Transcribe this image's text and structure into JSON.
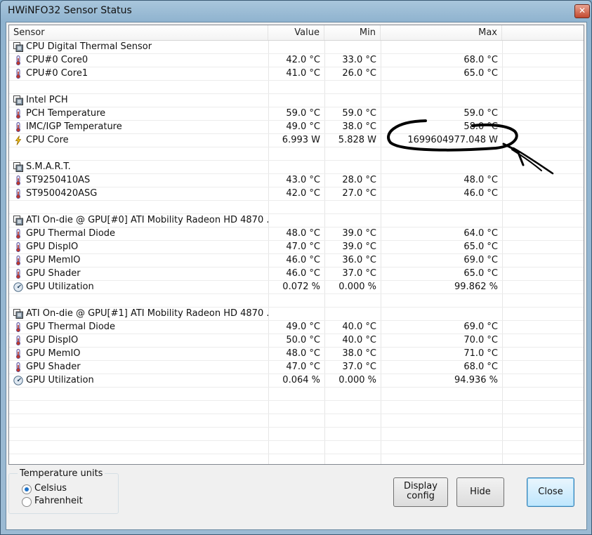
{
  "window": {
    "title": "HWiNFO32 Sensor Status"
  },
  "columns": {
    "sensor": "Sensor",
    "value": "Value",
    "min": "Min",
    "max": "Max"
  },
  "rows": [
    {
      "kind": "group",
      "icon": "chip-icon",
      "name": "CPU Digital Thermal Sensor",
      "value": "",
      "min": "",
      "max": ""
    },
    {
      "kind": "sensor",
      "icon": "thermometer-icon",
      "name": "CPU#0 Core0",
      "value": "42.0 °C",
      "min": "33.0 °C",
      "max": "68.0 °C"
    },
    {
      "kind": "sensor",
      "icon": "thermometer-icon",
      "name": "CPU#0 Core1",
      "value": "41.0 °C",
      "min": "26.0 °C",
      "max": "65.0 °C"
    },
    {
      "kind": "blank",
      "icon": "",
      "name": "",
      "value": "",
      "min": "",
      "max": ""
    },
    {
      "kind": "group",
      "icon": "chip-icon",
      "name": "Intel PCH",
      "value": "",
      "min": "",
      "max": ""
    },
    {
      "kind": "sensor",
      "icon": "thermometer-icon",
      "name": "PCH Temperature",
      "value": "59.0 °C",
      "min": "59.0 °C",
      "max": "59.0 °C"
    },
    {
      "kind": "sensor",
      "icon": "thermometer-icon",
      "name": "IMC/IGP Temperature",
      "value": "49.0 °C",
      "min": "38.0 °C",
      "max": "58.0 °C"
    },
    {
      "kind": "sensor",
      "icon": "lightning-icon",
      "name": "CPU Core",
      "value": "6.993 W",
      "min": "5.828 W",
      "max": "1699604977.048 W"
    },
    {
      "kind": "blank",
      "icon": "",
      "name": "",
      "value": "",
      "min": "",
      "max": ""
    },
    {
      "kind": "group",
      "icon": "chip-icon",
      "name": "S.M.A.R.T.",
      "value": "",
      "min": "",
      "max": ""
    },
    {
      "kind": "sensor",
      "icon": "thermometer-icon",
      "name": "ST9250410AS",
      "value": "43.0 °C",
      "min": "28.0 °C",
      "max": "48.0 °C"
    },
    {
      "kind": "sensor",
      "icon": "thermometer-icon",
      "name": "ST9500420ASG",
      "value": "42.0 °C",
      "min": "27.0 °C",
      "max": "46.0 °C"
    },
    {
      "kind": "blank",
      "icon": "",
      "name": "",
      "value": "",
      "min": "",
      "max": ""
    },
    {
      "kind": "group",
      "icon": "chip-icon",
      "name": "ATI On-die @ GPU[#0] ATI Mobility Radeon HD 4870 ...",
      "value": "",
      "min": "",
      "max": ""
    },
    {
      "kind": "sensor",
      "icon": "thermometer-icon",
      "name": "GPU Thermal Diode",
      "value": "48.0 °C",
      "min": "39.0 °C",
      "max": "64.0 °C"
    },
    {
      "kind": "sensor",
      "icon": "thermometer-icon",
      "name": "GPU DispIO",
      "value": "47.0 °C",
      "min": "39.0 °C",
      "max": "65.0 °C"
    },
    {
      "kind": "sensor",
      "icon": "thermometer-icon",
      "name": "GPU MemIO",
      "value": "46.0 °C",
      "min": "36.0 °C",
      "max": "69.0 °C"
    },
    {
      "kind": "sensor",
      "icon": "thermometer-icon",
      "name": "GPU Shader",
      "value": "46.0 °C",
      "min": "37.0 °C",
      "max": "65.0 °C"
    },
    {
      "kind": "sensor",
      "icon": "gauge-icon",
      "name": "GPU Utilization",
      "value": "0.072 %",
      "min": "0.000 %",
      "max": "99.862 %"
    },
    {
      "kind": "blank",
      "icon": "",
      "name": "",
      "value": "",
      "min": "",
      "max": ""
    },
    {
      "kind": "group",
      "icon": "chip-icon",
      "name": "ATI On-die @ GPU[#1] ATI Mobility Radeon HD 4870 ...",
      "value": "",
      "min": "",
      "max": ""
    },
    {
      "kind": "sensor",
      "icon": "thermometer-icon",
      "name": "GPU Thermal Diode",
      "value": "49.0 °C",
      "min": "40.0 °C",
      "max": "69.0 °C"
    },
    {
      "kind": "sensor",
      "icon": "thermometer-icon",
      "name": "GPU DispIO",
      "value": "50.0 °C",
      "min": "40.0 °C",
      "max": "70.0 °C"
    },
    {
      "kind": "sensor",
      "icon": "thermometer-icon",
      "name": "GPU MemIO",
      "value": "48.0 °C",
      "min": "38.0 °C",
      "max": "71.0 °C"
    },
    {
      "kind": "sensor",
      "icon": "thermometer-icon",
      "name": "GPU Shader",
      "value": "47.0 °C",
      "min": "37.0 °C",
      "max": "68.0 °C"
    },
    {
      "kind": "sensor",
      "icon": "gauge-icon",
      "name": "GPU Utilization",
      "value": "0.064 %",
      "min": "0.000 %",
      "max": "94.936 %"
    }
  ],
  "units": {
    "label": "Temperature units",
    "options": [
      "Celsius",
      "Fahrenheit"
    ],
    "selected": "Celsius"
  },
  "buttons": {
    "display_config": "Display config",
    "hide": "Hide",
    "close": "Close"
  },
  "colors": {
    "ink_annotation": "#000000",
    "default_button": "#3c7fb1"
  }
}
